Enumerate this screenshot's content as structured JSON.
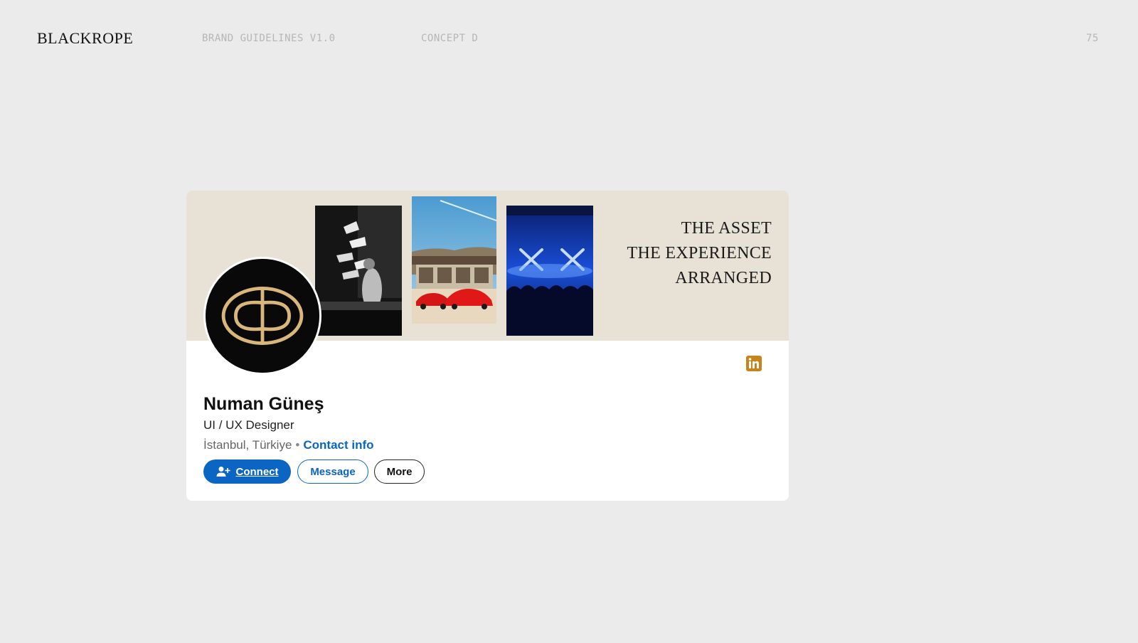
{
  "header": {
    "brand": "BLACKROPE",
    "guidelines": "BRAND GUIDELINES V1.0",
    "concept": "CONCEPT D",
    "page_number": "75"
  },
  "banner": {
    "tagline": [
      "THE ASSET",
      "THE EXPERIENCE",
      "ARRANGED"
    ],
    "background_color": "#e8e2d6",
    "photos": [
      {
        "subject": "party-photo-icon"
      },
      {
        "subject": "ferrari-cars-photo-icon"
      },
      {
        "subject": "concert-lights-photo-icon"
      }
    ]
  },
  "profile": {
    "avatar_icon": "blackrope-logo-icon",
    "name": "Numan Güneş",
    "headline": "UI / UX Designer",
    "location": "İstanbul, Türkiye",
    "separator": "•",
    "contact_link": "Contact info",
    "social_icon": "linkedin-icon",
    "social_icon_color": "#c8841a"
  },
  "actions": {
    "connect": "Connect",
    "message": "Message",
    "more": "More"
  },
  "colors": {
    "accent": "#0a66c2",
    "page_background": "#ebebeb",
    "logo_gold": "#d9b77a"
  }
}
